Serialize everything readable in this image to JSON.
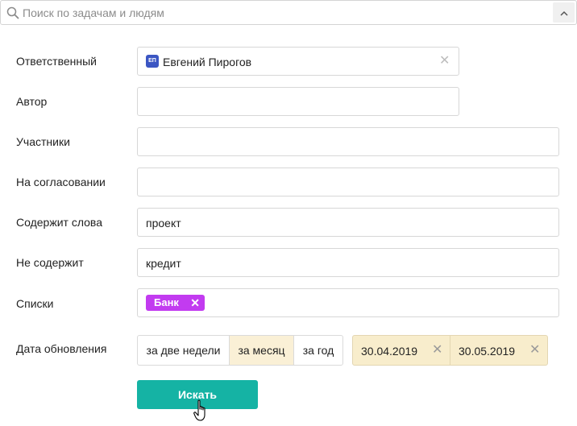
{
  "search": {
    "placeholder": "Поиск по задачам и людям",
    "value": ""
  },
  "form": {
    "responsible": {
      "label": "Ответственный",
      "avatar_initials": "ЕП",
      "user_name": "Евгений Пирогов"
    },
    "author": {
      "label": "Автор",
      "value": ""
    },
    "participants": {
      "label": "Участники",
      "value": ""
    },
    "approval": {
      "label": "На согласовании",
      "value": ""
    },
    "contains_words": {
      "label": "Содержит слова",
      "value": "проект"
    },
    "not_contains": {
      "label": "Не содержит",
      "value": "кредит"
    },
    "lists": {
      "label": "Списки",
      "tags": [
        "Банк"
      ]
    },
    "update_date": {
      "label": "Дата обновления",
      "periods": [
        "за две недели",
        "за месяц",
        "за год"
      ],
      "active_period": "за месяц",
      "date_from": "30.04.2019",
      "date_to": "30.05.2019"
    }
  },
  "actions": {
    "search_label": "Искать"
  },
  "colors": {
    "accent_button": "#15b3a4",
    "tag": "#c23bf0",
    "avatar": "#3b56c3",
    "active_period_bg": "#faf0d6",
    "date_bg": "#f8edcc"
  },
  "icons": {
    "search": "search-icon",
    "collapse": "chevron-up-icon",
    "clear": "close-icon",
    "cursor": "hand-pointer-icon"
  }
}
